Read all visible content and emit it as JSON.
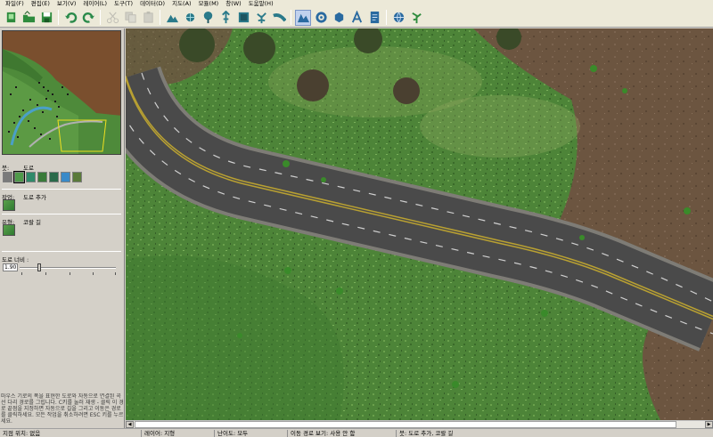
{
  "menu": [
    "파일(F)",
    "편집(E)",
    "보기(V)",
    "레이어(L)",
    "도구(T)",
    "데이터(D)",
    "지도(A)",
    "모듈(M)",
    "창(W)",
    "도움말(H)"
  ],
  "toolbar": {
    "buttons": [
      {
        "name": "new-map-icon",
        "color": "#2e8b3d"
      },
      {
        "name": "open-map-icon",
        "color": "#2e8b3d"
      },
      {
        "name": "save-map-icon",
        "color": "#2e8b3d"
      },
      {
        "name": "undo-icon",
        "color": "#2a8a4a"
      },
      {
        "name": "redo-icon",
        "color": "#2a8a4a"
      },
      {
        "name": "cut-icon",
        "color": "#8a8a8a"
      },
      {
        "name": "copy-icon",
        "color": "#8a8a8a"
      },
      {
        "name": "paste-icon",
        "color": "#8a8a8a"
      },
      {
        "name": "terrain-tool-icon",
        "color": "#2a7a8a"
      },
      {
        "name": "doodad-tool-icon",
        "color": "#2a7a8a"
      },
      {
        "name": "tree-tool-icon",
        "color": "#2a7a8a"
      },
      {
        "name": "unit-tool-icon",
        "color": "#2a7a8a"
      },
      {
        "name": "texture-tool-icon",
        "color": "#2a7a8a"
      },
      {
        "name": "vegetation-tool-icon",
        "color": "#2a7a8a"
      },
      {
        "name": "road-tool-icon",
        "color": "#2a7a8a"
      },
      {
        "name": "cliff-tool-icon",
        "color": "#2a6aa0"
      },
      {
        "name": "settings-tool-icon",
        "color": "#2a6aa0"
      },
      {
        "name": "object-tool-icon",
        "color": "#2a6aa0"
      },
      {
        "name": "text-tool-icon",
        "color": "#2a6aa0"
      },
      {
        "name": "document-tool-icon",
        "color": "#2a6aa0"
      },
      {
        "name": "globe-tool-icon",
        "color": "#2a6aa0"
      },
      {
        "name": "plant-tool-icon",
        "color": "#2e8b3d"
      }
    ]
  },
  "panel": {
    "brush_label": "붓:",
    "brush_value": "도로",
    "action_label": "작업:",
    "action_value": "도로 추가",
    "type_label": "유형:",
    "type_value": "코랄 길",
    "width_label": "도로 너비 :",
    "width_value": "1.90",
    "width_slider": 0.2,
    "help_text": "마우스 기로의 폭을 표현한 도로와 자동으로 연결된 곡선 다리 경로를 그립니다. C키를 눌러 재생 - 클릭 이 경로 끝점을 지정하면 자동으로 길을 그리고 이동은 경로를 클릭하세요. 모든 작업을 취소하려면 ESC 키를 누르세요."
  },
  "statusbar": {
    "coord": "지점 위치: 없음",
    "layer": "레이어: 지형",
    "difficulty": "난이도: 모두",
    "path_view": "이동 경로 보기: 사용 안 함",
    "brush": "붓: 도로 추가, 코랄 길"
  },
  "colors": {
    "grass": "#4f8a3a",
    "dirt": "#6e5640",
    "road": "#4a4a4a",
    "road_centerline": "#b8a032",
    "road_dash": "#d0d0d0",
    "curb": "#8a8a88"
  }
}
